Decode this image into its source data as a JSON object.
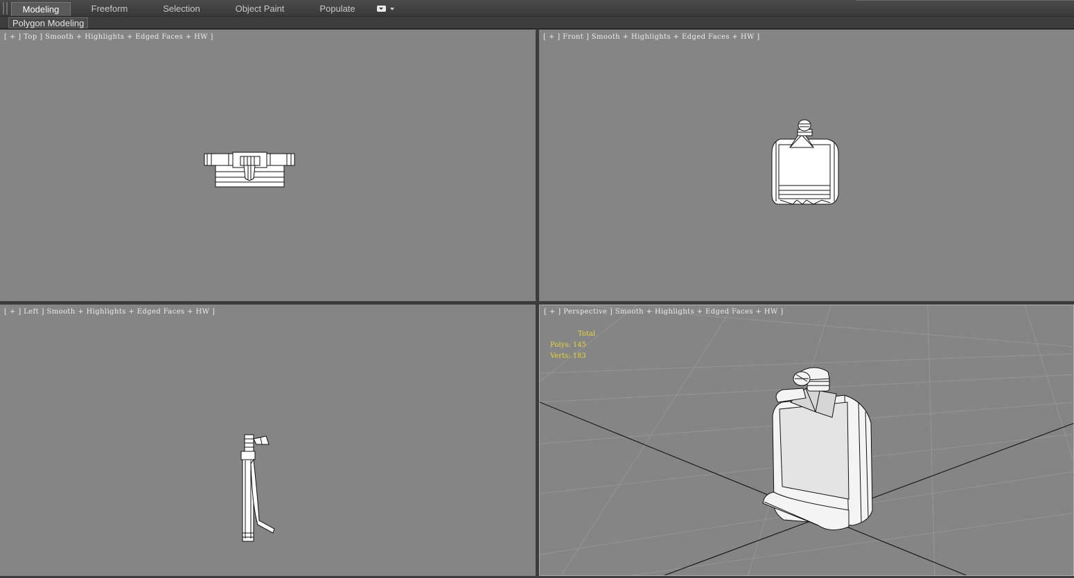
{
  "ribbon": {
    "tabs": [
      {
        "label": "Modeling",
        "active": true
      },
      {
        "label": "Freeform",
        "active": false
      },
      {
        "label": "Selection",
        "active": false
      },
      {
        "label": "Object Paint",
        "active": false
      },
      {
        "label": "Populate",
        "active": false
      }
    ],
    "options_icon": "ribbon-options-icon",
    "panel_label": "Polygon Modeling"
  },
  "viewports": {
    "top": {
      "label": "[ + ] Top ] Smooth + Highlights + Edged Faces + HW ]"
    },
    "front": {
      "label": "[ + ] Front ] Smooth + Highlights + Edged Faces + HW ]"
    },
    "left": {
      "label": "[ + ] Left ] Smooth + Highlights + Edged Faces + HW ]"
    },
    "perspective": {
      "label": "[ + ] Perspective ] Smooth + Highlights + Edged Faces + HW ]"
    }
  },
  "stats": {
    "total": "Total",
    "polys": "Polys: 145",
    "verts": "Verts: 183"
  },
  "colors": {
    "viewport_bg": "#858585",
    "stats_text": "#e8d63a",
    "active_tab": "#5a5a5a"
  }
}
